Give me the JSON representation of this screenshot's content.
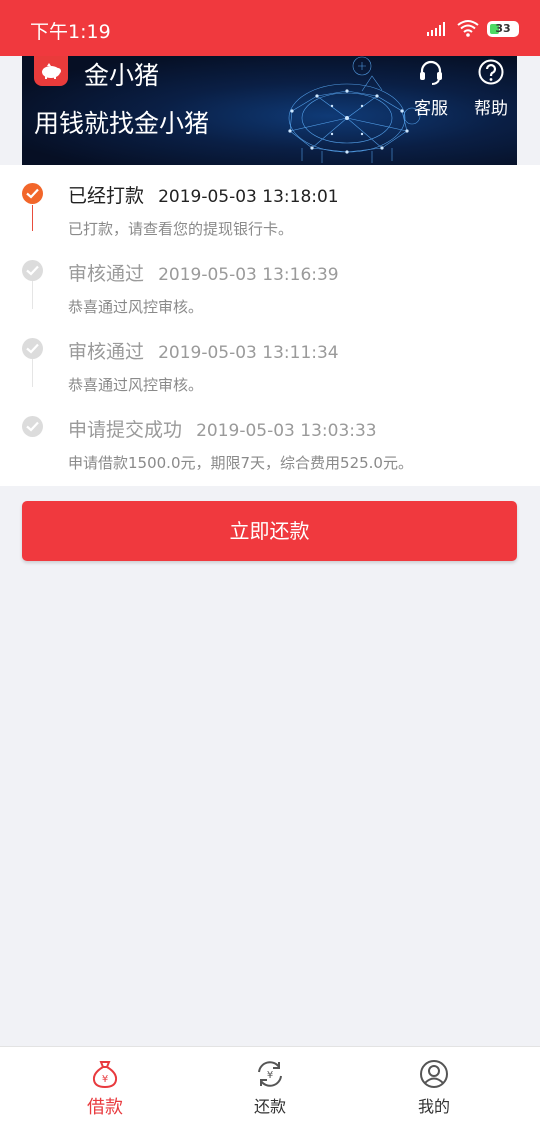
{
  "status_bar": {
    "time": "下午1:19",
    "battery": "33",
    "icons": [
      "signal-icon",
      "wifi-icon",
      "battery-icon"
    ]
  },
  "banner": {
    "brand": "金小猪",
    "slogan": "用钱就找金小猪",
    "service_label": "客服",
    "help_label": "帮助"
  },
  "timeline": [
    {
      "title": "已经打款",
      "time": "2019-05-03 13:18:01",
      "desc": "已打款，请查看您的提现银行卡。",
      "state": "active"
    },
    {
      "title": "审核通过",
      "time": "2019-05-03 13:16:39",
      "desc": "恭喜通过风控审核。",
      "state": "pending"
    },
    {
      "title": "审核通过",
      "time": "2019-05-03 13:11:34",
      "desc": "恭喜通过风控审核。",
      "state": "pending"
    },
    {
      "title": "申请提交成功",
      "time": "2019-05-03 13:03:33",
      "desc": "申请借款1500.0元，期限7天，综合费用525.0元。",
      "state": "pending"
    }
  ],
  "actions": {
    "repay_now": "立即还款"
  },
  "bottom_nav": [
    {
      "label": "借款",
      "icon": "money-bag-icon",
      "active": true
    },
    {
      "label": "还款",
      "icon": "repay-cycle-icon",
      "active": false
    },
    {
      "label": "我的",
      "icon": "user-icon",
      "active": false
    }
  ],
  "colors": {
    "brand_red": "#f0393e",
    "active_orange": "#f2662a",
    "background": "#f1f2f6"
  }
}
